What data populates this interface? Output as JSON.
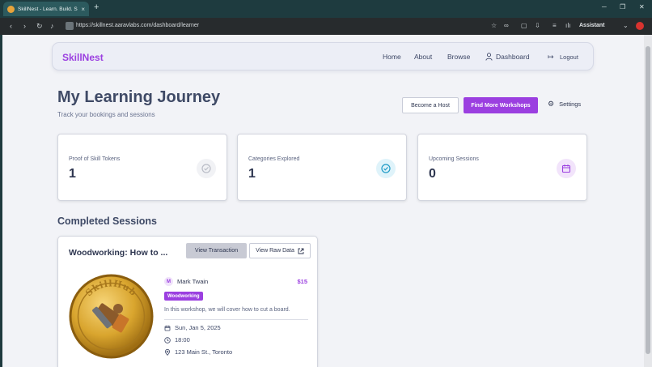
{
  "browser": {
    "tab_title": "SkillNest - Learn. Build. Share.",
    "tab_close": "×",
    "new_tab": "+",
    "url": "https://skillnest.aaravlabs.com/dashboard/learner",
    "assistant_label": "Assistant"
  },
  "navbar": {
    "brand": "SkillNest",
    "links": [
      "Home",
      "About",
      "Browse",
      "Dashboard"
    ],
    "logout": "Logout"
  },
  "header": {
    "title": "My Learning Journey",
    "subtitle": "Track your bookings and sessions",
    "become_host": "Become a Host",
    "find_workshops": "Find More Workshops",
    "settings": "Settings"
  },
  "stats": [
    {
      "label": "Proof of Skill Tokens",
      "value": "1",
      "icon": "check-circle-icon"
    },
    {
      "label": "Categories Explored",
      "value": "1",
      "icon": "check-circle-icon"
    },
    {
      "label": "Upcoming Sessions",
      "value": "0",
      "icon": "calendar-icon"
    }
  ],
  "completed": {
    "title": "Completed Sessions",
    "session": {
      "title": "Woodworking: How to ...",
      "view_transaction": "View Transaction",
      "view_raw": "View Raw Data",
      "coin_text": "SkillHub",
      "host_initial": "M",
      "host_name": "Mark Twain",
      "price": "$15",
      "category": "Woodworking",
      "description": "In this workshop, we will cover how to cut a board.",
      "date": "Sun, Jan 5, 2025",
      "time": "18:00",
      "location": "123 Main St., Toronto"
    }
  },
  "colors": {
    "accent": "#9b3fe0",
    "accent_text": "#2e3650"
  }
}
